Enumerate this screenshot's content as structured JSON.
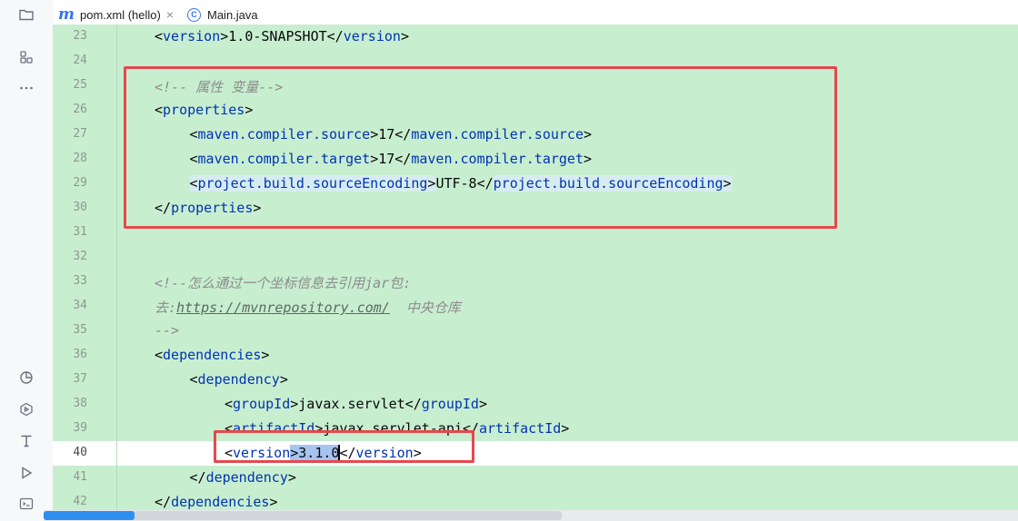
{
  "tabs": [
    {
      "label": "pom.xml (hello)",
      "icon": "maven-file-icon",
      "active": true
    },
    {
      "label": "Main.java",
      "icon": "java-class-icon",
      "active": false
    }
  ],
  "icons": {
    "maven_glyph": "m",
    "class_glyph": "C",
    "close_glyph": "×"
  },
  "colors": {
    "editor_bg": "#c8eed0",
    "tag": "#0033b3",
    "comment": "#8c8c8c",
    "annotation": "#e5484d",
    "selection": "#a6c4f0"
  },
  "editor": {
    "current_line": "40",
    "lines": [
      {
        "num": "23",
        "indent": 1,
        "tokens": [
          [
            "<",
            "b"
          ],
          [
            "version",
            "tag"
          ],
          [
            ">1.0-SNAPSHOT</",
            "b"
          ],
          [
            "version",
            "tag"
          ],
          [
            ">",
            "b"
          ]
        ]
      },
      {
        "num": "24",
        "indent": 0,
        "tokens": []
      },
      {
        "num": "25",
        "indent": 1,
        "tokens": [
          [
            "<!-- 属性 变量-->",
            "cm"
          ]
        ]
      },
      {
        "num": "26",
        "indent": 1,
        "tokens": [
          [
            "<",
            "b"
          ],
          [
            "properties",
            "tag"
          ],
          [
            ">",
            "b"
          ]
        ]
      },
      {
        "num": "27",
        "indent": 2,
        "tokens": [
          [
            "<",
            "b"
          ],
          [
            "maven.compiler.source",
            "tag"
          ],
          [
            ">17</",
            "b"
          ],
          [
            "maven.compiler.source",
            "tag"
          ],
          [
            ">",
            "b"
          ]
        ]
      },
      {
        "num": "28",
        "indent": 2,
        "tokens": [
          [
            "<",
            "b"
          ],
          [
            "maven.compiler.target",
            "tag"
          ],
          [
            ">17</",
            "b"
          ],
          [
            "maven.compiler.target",
            "tag"
          ],
          [
            ">",
            "b"
          ]
        ]
      },
      {
        "num": "29",
        "indent": 2,
        "tokens": [
          [
            "<",
            "hl"
          ],
          [
            "project.build.sourceEncoding",
            "tag-hl"
          ],
          [
            ">",
            "hl"
          ],
          [
            "UTF-8</",
            "b"
          ],
          [
            "project.build.sourceEncoding",
            "tag-hl"
          ],
          [
            ">",
            "hl"
          ]
        ]
      },
      {
        "num": "30",
        "indent": 1,
        "tokens": [
          [
            "</",
            "b"
          ],
          [
            "properties",
            "tag"
          ],
          [
            ">",
            "b"
          ]
        ]
      },
      {
        "num": "31",
        "indent": 0,
        "tokens": []
      },
      {
        "num": "32",
        "indent": 0,
        "tokens": []
      },
      {
        "num": "33",
        "indent": 1,
        "tokens": [
          [
            "<!--怎么通过一个坐标信息去引用jar包:",
            "cm"
          ]
        ]
      },
      {
        "num": "34",
        "indent": 1,
        "tokens": [
          [
            "去:",
            "cm"
          ],
          [
            "https://mvnrepository.com/",
            "link"
          ],
          [
            "  中央仓库",
            "cm"
          ]
        ]
      },
      {
        "num": "35",
        "indent": 1,
        "tokens": [
          [
            "-->",
            "cm"
          ]
        ]
      },
      {
        "num": "36",
        "indent": 1,
        "tokens": [
          [
            "<",
            "b"
          ],
          [
            "dependencies",
            "tag"
          ],
          [
            ">",
            "b"
          ]
        ]
      },
      {
        "num": "37",
        "indent": 2,
        "tokens": [
          [
            "<",
            "b"
          ],
          [
            "dependency",
            "tag"
          ],
          [
            ">",
            "b"
          ]
        ]
      },
      {
        "num": "38",
        "indent": 3,
        "tokens": [
          [
            "<",
            "b"
          ],
          [
            "groupId",
            "tag"
          ],
          [
            ">javax.servlet</",
            "b"
          ],
          [
            "groupId",
            "tag"
          ],
          [
            ">",
            "b"
          ]
        ]
      },
      {
        "num": "39",
        "indent": 3,
        "tokens": [
          [
            "<",
            "b"
          ],
          [
            "artifactId",
            "tag"
          ],
          [
            ">javax.servlet-api</",
            "b"
          ],
          [
            "artifactId",
            "tag"
          ],
          [
            ">",
            "b"
          ]
        ]
      },
      {
        "num": "40",
        "indent": 3,
        "tokens": [
          [
            "<",
            "b"
          ],
          [
            "version",
            "tag"
          ],
          [
            ">",
            "sel"
          ],
          [
            "3.1.0",
            "sel"
          ],
          [
            "caret",
            "caret"
          ],
          [
            "</",
            "b"
          ],
          [
            "version",
            "tag"
          ],
          [
            ">",
            "b"
          ]
        ]
      },
      {
        "num": "41",
        "indent": 2,
        "tokens": [
          [
            "</",
            "b"
          ],
          [
            "dependency",
            "tag"
          ],
          [
            ">",
            "b"
          ]
        ]
      },
      {
        "num": "42",
        "indent": 1,
        "tokens": [
          [
            "</",
            "b"
          ],
          [
            "dependencies",
            "tag"
          ],
          [
            ">",
            "b"
          ]
        ]
      }
    ]
  }
}
